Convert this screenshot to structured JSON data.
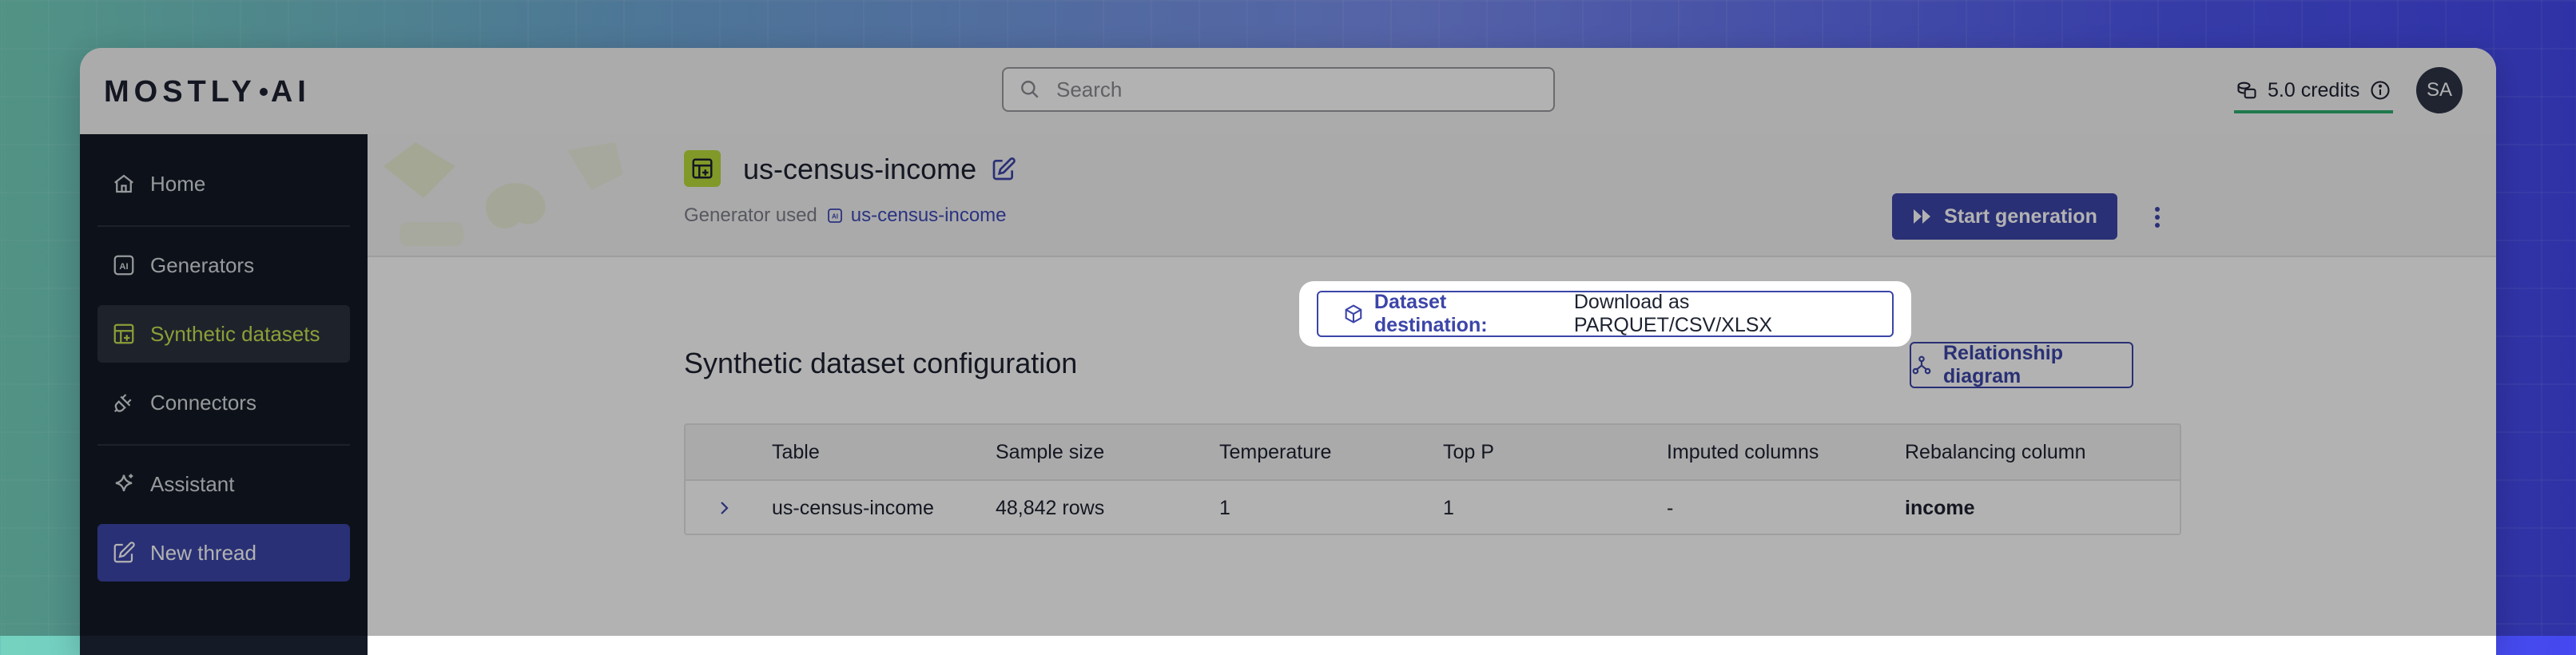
{
  "app": {
    "logo_text_left": "MOSTLY",
    "logo_text_right": "AI"
  },
  "topbar": {
    "search_placeholder": "Search",
    "credits": "5.0 credits",
    "avatar_initials": "SA"
  },
  "sidebar": {
    "items": [
      {
        "label": "Home",
        "icon": "home-icon"
      },
      {
        "label": "Generators",
        "icon": "ai-chip-icon"
      },
      {
        "label": "Synthetic datasets",
        "icon": "dataset-icon"
      },
      {
        "label": "Connectors",
        "icon": "plug-icon"
      },
      {
        "label": "Assistant",
        "icon": "sparkle-icon"
      },
      {
        "label": "New thread",
        "icon": "edit-icon"
      }
    ],
    "active_item": "Synthetic datasets"
  },
  "header": {
    "title": "us-census-income",
    "generator_used_label": "Generator used",
    "generator_name": "us-census-income",
    "start_button": "Start generation"
  },
  "config": {
    "section_title": "Synthetic dataset configuration",
    "destination_label": "Dataset destination:",
    "destination_value": "Download as PARQUET/CSV/XLSX",
    "relationship_button": "Relationship diagram"
  },
  "table": {
    "columns": [
      "Table",
      "Sample size",
      "Temperature",
      "Top P",
      "Imputed columns",
      "Rebalancing column"
    ],
    "rows": [
      [
        "us-census-income",
        "48,842 rows",
        "1",
        "1",
        "-",
        "income"
      ]
    ]
  },
  "colors": {
    "accent": "#3c45a8",
    "sidebar_bg": "#141b26",
    "active_text": "#c9e34f",
    "credits_underline": "#2fae6d",
    "title_icon_bg": "#b9dc3c"
  }
}
